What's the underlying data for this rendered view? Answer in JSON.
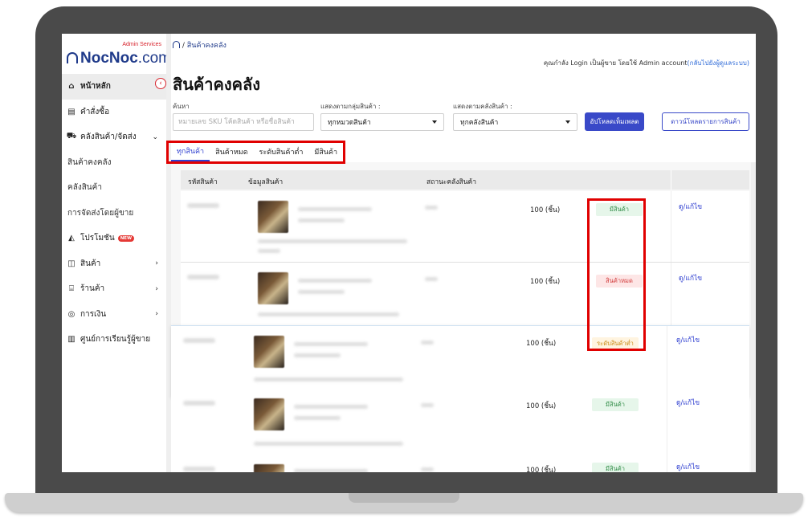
{
  "brand": {
    "admin_label": "Admin Services",
    "name_bold": "NocNoc",
    "name_suffix": ".com"
  },
  "sidebar": {
    "items": [
      {
        "label": "หน้าหลัก",
        "icon": "home-icon"
      },
      {
        "label": "คำสั่งซื้อ",
        "icon": "document-icon"
      },
      {
        "label": "คลังสินค้า/จัดส่ง",
        "icon": "truck-icon"
      },
      {
        "label": "สินค้าคงคลัง"
      },
      {
        "label": "คลังสินค้า"
      },
      {
        "label": "การจัดส่งโดยผู้ขาย"
      },
      {
        "label": "โปรโมชัน",
        "icon": "megaphone-icon",
        "badge": "NEW"
      },
      {
        "label": "สินค้า",
        "icon": "box-icon"
      },
      {
        "label": "ร้านค้า",
        "icon": "store-icon"
      },
      {
        "label": "การเงิน",
        "icon": "money-icon"
      },
      {
        "label": "ศูนย์การเรียนรู้ผู้ขาย",
        "icon": "book-icon"
      }
    ]
  },
  "header": {
    "breadcrumb_sep": "/",
    "breadcrumb_current": "สินค้าคงคลัง",
    "login_note": "คุณกำลัง Login เป็นผู้ขาย โดยใช้ Admin account",
    "login_link": "(กลับไปยังผู้ดูแลระบบ)",
    "page_title": "สินค้าคงคลัง"
  },
  "filters": {
    "search_label": "ค้นหา",
    "search_placeholder": "หมายเลข SKU โค้ดสินค้า หรือชื่อสินค้า",
    "group_label": "แสดงตามกลุ่มสินค้า :",
    "group_value": "ทุกหมวดสินค้า",
    "warehouse_label": "แสดงตามคลังสินค้า :",
    "warehouse_value": "ทุกคลังสินค้า",
    "upload_button": "อัปโหลดเท็มเพลต",
    "download_button": "ดาวน์โหลดรายการสินค้า"
  },
  "tabs": [
    "ทุกสินค้า",
    "สินค้าหมด",
    "ระดับสินค้าต่ำ",
    "มีสินค้า"
  ],
  "table": {
    "columns": [
      "รหัสสินค้า",
      "ข้อมูลสินค้า",
      "สถานะคลังสินค้า"
    ],
    "rows": [
      {
        "qty": "100 (ชิ้น)",
        "status": "มีสินค้า",
        "status_kind": "in",
        "action": "ดู/แก้ไข"
      },
      {
        "qty": "100 (ชิ้น)",
        "status": "สินค้าหมด",
        "status_kind": "out",
        "action": "ดู/แก้ไข"
      },
      {
        "qty": "100 (ชิ้น)",
        "status": "ระดับสินค้าต่ำ",
        "status_kind": "low",
        "action": "ดู/แก้ไข"
      },
      {
        "qty": "100 (ชิ้น)",
        "status": "มีสินค้า",
        "status_kind": "in",
        "action": "ดู/แก้ไข"
      },
      {
        "qty": "100 (ชิ้น)",
        "status": "มีสินค้า",
        "status_kind": "in",
        "action": "ดู/แก้ไข"
      }
    ]
  },
  "colors": {
    "primary": "#3949c8",
    "highlight": "#e00000",
    "in_stock": "#2e8b45",
    "out_of_stock": "#d23c3c",
    "low_stock": "#c98a12"
  }
}
